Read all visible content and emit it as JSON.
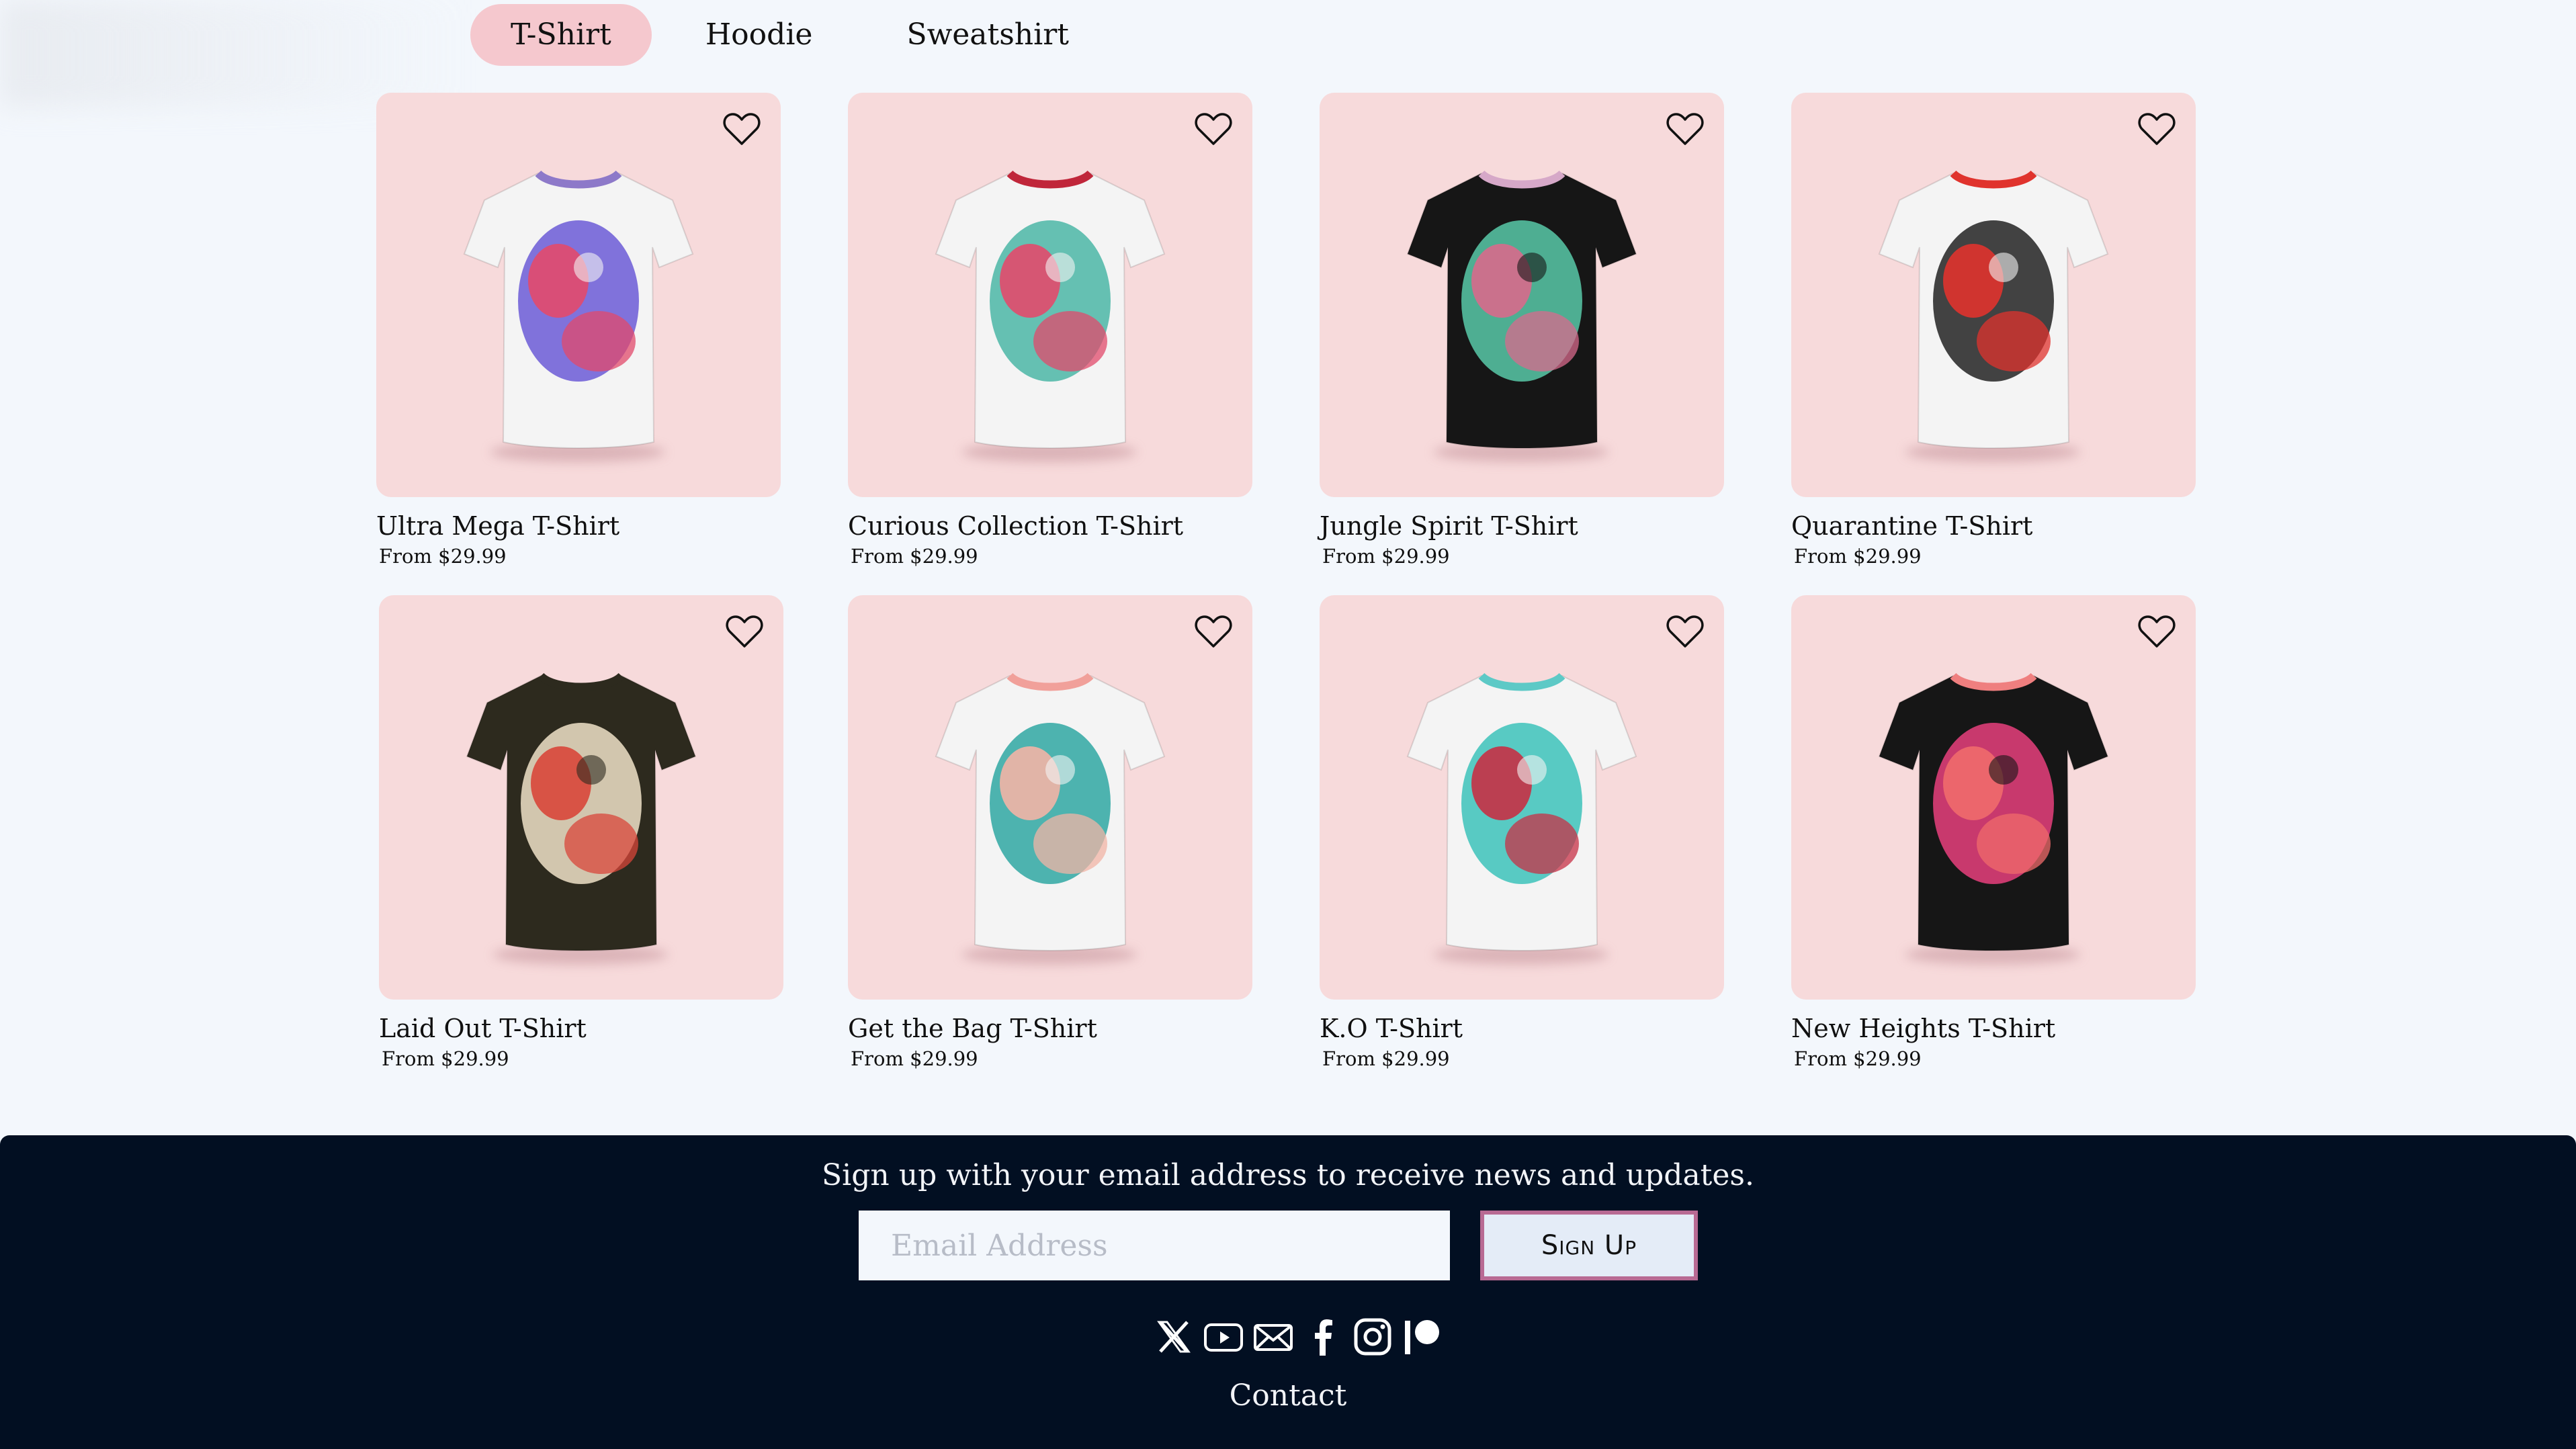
{
  "tabs": [
    {
      "label": "T-Shirt",
      "active": true
    },
    {
      "label": "Hoodie",
      "active": false
    },
    {
      "label": "Sweatshirt",
      "active": false
    }
  ],
  "products": [
    {
      "name": "Ultra Mega T-Shirt",
      "price": "From $29.99",
      "shirt_color": "#f4f4f4",
      "collar": "#8d79c9",
      "art": [
        "#6b5ad6",
        "#e24a6b"
      ]
    },
    {
      "name": "Curious Collection T-Shirt",
      "price": "From $29.99",
      "shirt_color": "#f4f4f4",
      "collar": "#c0263a",
      "art": [
        "#4bb6a6",
        "#e24a6b"
      ]
    },
    {
      "name": "Jungle Spirit T-Shirt",
      "price": "From $29.99",
      "shirt_color": "#161616",
      "collar": "#d6a8c8",
      "art": [
        "#58c9a8",
        "#d86a8c"
      ]
    },
    {
      "name": "Quarantine T-Shirt",
      "price": "From $29.99",
      "shirt_color": "#f4f4f4",
      "collar": "#e0332d",
      "art": [
        "#222222",
        "#e0332d"
      ]
    },
    {
      "name": "Laid Out T-Shirt",
      "price": "From $29.99",
      "shirt_color": "#2d2a1e",
      "collar": "#2d2a1e",
      "art": [
        "#f0e2c8",
        "#d8463a"
      ]
    },
    {
      "name": "Get the Bag T-Shirt",
      "price": "From $29.99",
      "shirt_color": "#f4f4f4",
      "collar": "#f1a09a",
      "art": [
        "#2fa7a2",
        "#f2b4a6"
      ]
    },
    {
      "name": "K.O T-Shirt",
      "price": "From $29.99",
      "shirt_color": "#f4f4f4",
      "collar": "#5dc9c6",
      "art": [
        "#3cc2ba",
        "#c73045"
      ]
    },
    {
      "name": "New Heights T-Shirt",
      "price": "From $29.99",
      "shirt_color": "#161616",
      "collar": "#ef7f7f",
      "art": [
        "#e8407c",
        "#f06b6b"
      ]
    }
  ],
  "footer": {
    "signup_text": "Sign up with your email address to receive news and updates.",
    "email_placeholder": "Email Address",
    "signup_button": "Sign Up",
    "contact": "Contact",
    "socials": [
      "x-icon",
      "youtube-icon",
      "mail-icon",
      "facebook-icon",
      "instagram-icon",
      "patreon-icon"
    ]
  },
  "colors": {
    "page_bg": "#f3f7fc",
    "tab_active_bg": "#f5c8ce",
    "card_bg": "#f7dadb",
    "footer_bg": "#020f22",
    "button_border": "#b86a93"
  }
}
